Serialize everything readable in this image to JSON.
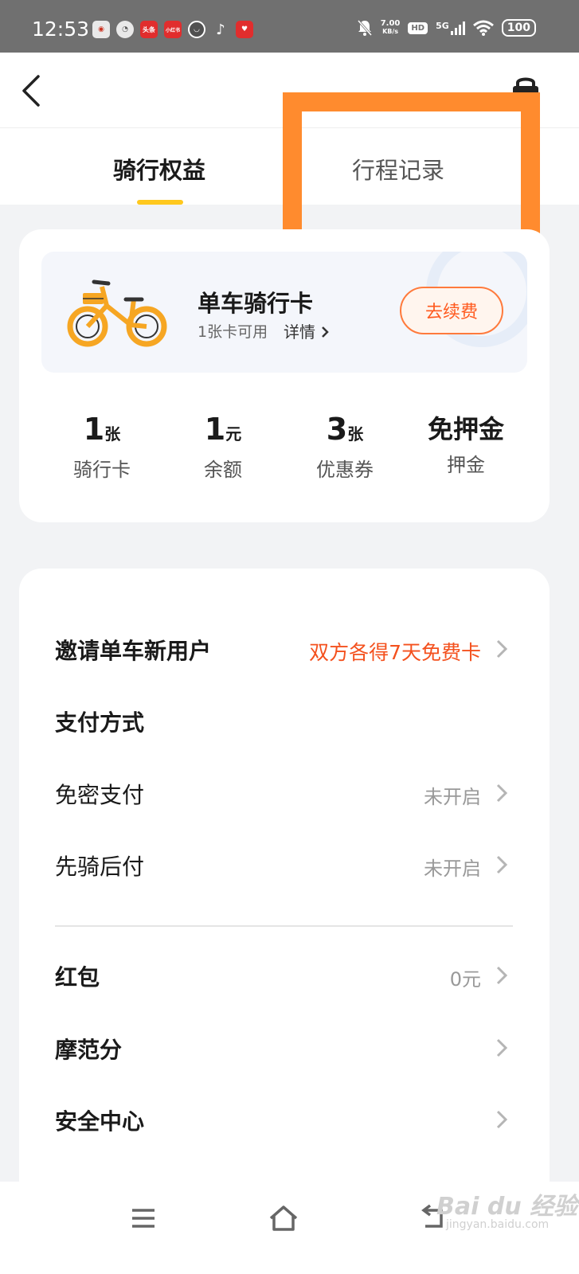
{
  "status_bar": {
    "time": "12:53",
    "net_speed_value": "7.00",
    "net_speed_unit": "KB/s",
    "hd": "HD",
    "network": "5G",
    "battery": "100",
    "app_icons": [
      "weibo-icon",
      "speedometer-icon",
      "toutiao-icon",
      "xiaohongshu-icon",
      "cat-app-icon",
      "tiktok-icon",
      "heart-app-icon"
    ],
    "app_icon_texts": {
      "toutiao": "头条",
      "xiaohongshu": "小红书"
    }
  },
  "tabs": [
    {
      "label": "骑行权益",
      "active": true
    },
    {
      "label": "行程记录",
      "active": false
    }
  ],
  "ride_card": {
    "title": "单车骑行卡",
    "subtitle": "1张卡可用",
    "detail_link": "详情",
    "renew_button": "去续费"
  },
  "stats": [
    {
      "value": "1",
      "unit": "张",
      "label": "骑行卡"
    },
    {
      "value": "1",
      "unit": "元",
      "label": "余额"
    },
    {
      "value": "3",
      "unit": "张",
      "label": "优惠券"
    },
    {
      "value": "免押金",
      "unit": "",
      "label": "押金"
    }
  ],
  "menu": {
    "invite": {
      "label": "邀请单车新用户",
      "value": "双方各得7天免费卡"
    },
    "payment_section": "支付方式",
    "password_free": {
      "label": "免密支付",
      "value": "未开启"
    },
    "ride_first": {
      "label": "先骑后付",
      "value": "未开启"
    },
    "red_packet": {
      "label": "红包",
      "value": "0元"
    },
    "mobike_score": {
      "label": "摩范分",
      "value": ""
    },
    "safety": {
      "label": "安全中心",
      "value": ""
    }
  },
  "watermark": {
    "text": "Bai du 经验",
    "sub": "jingyan.baidu.com"
  },
  "colors": {
    "accent_yellow": "#ffc81e",
    "highlight_orange": "#ff8b2e",
    "renew_orange": "#ff5a1f",
    "invite_red": "#f4511e"
  }
}
